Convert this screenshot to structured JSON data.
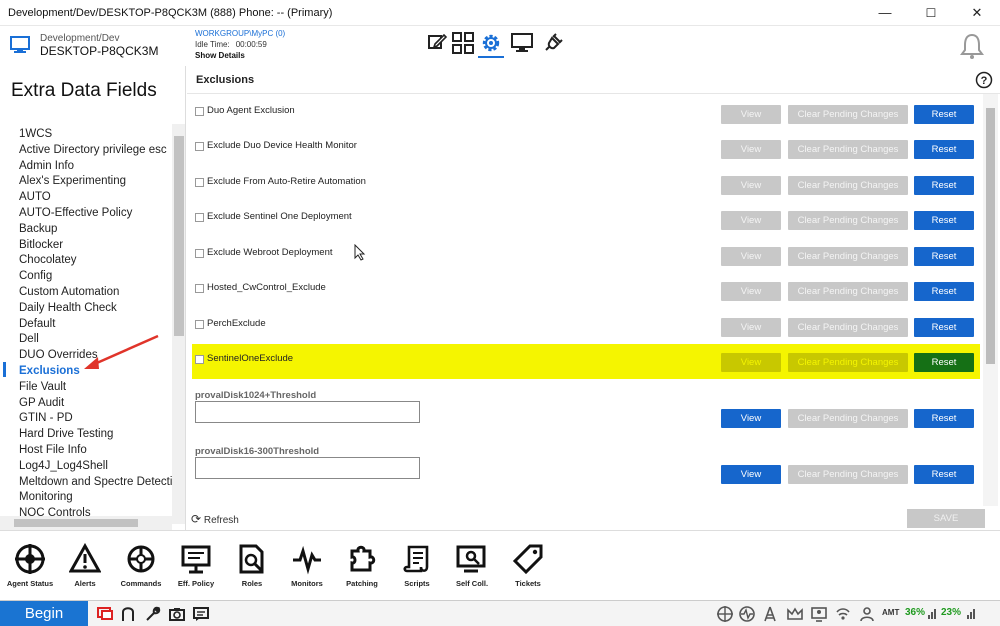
{
  "window": {
    "title": "Development/Dev/DESKTOP-P8QCK3M (888) Phone: -- (Primary)",
    "minimize": "—",
    "maximize": "☐",
    "close": "✕"
  },
  "header": {
    "path": "Development/Dev",
    "hostname": "DESKTOP-P8QCK3M",
    "workgroup": "WORKGROUP\\MyPC (0)",
    "idle_label": "Idle Time:",
    "idle_value": "00:00:59",
    "show_details": "Show Details",
    "icons": [
      "edit-icon",
      "grid-icon",
      "gear-icon",
      "monitor-icon",
      "plug-icon",
      "bell-icon"
    ]
  },
  "sidebar": {
    "title": "Extra Data Fields",
    "items": [
      "1WCS",
      "Active Directory privilege esc",
      "Admin Info",
      "Alex's Experimenting",
      "AUTO",
      "AUTO-Effective Policy",
      "Backup",
      "Bitlocker",
      "Chocolatey",
      "Config",
      "Custom Automation",
      "Daily Health Check",
      "Default",
      "Dell",
      "DUO Overrides",
      "Exclusions",
      "File Vault",
      "GP Audit",
      "GTIN - PD",
      "Hard Drive Testing",
      "Host File Info",
      "Log4J_Log4Shell",
      "Meltdown and Spectre Detection",
      "Monitoring",
      "NOC Controls"
    ],
    "active": "Exclusions"
  },
  "main": {
    "title": "Exclusions",
    "view_label": "View",
    "clear_label": "Clear Pending Changes",
    "reset_label": "Reset",
    "rows": [
      {
        "label": "Duo Agent Exclusion"
      },
      {
        "label": "Exclude Duo Device Health Monitor"
      },
      {
        "label": "Exclude From Auto-Retire Automation"
      },
      {
        "label": "Exclude Sentinel One Deployment"
      },
      {
        "label": "Exclude Webroot Deployment"
      },
      {
        "label": "Hosted_CwControl_Exclude"
      },
      {
        "label": "PerchExclude"
      },
      {
        "label": "SentinelOneExclude"
      }
    ],
    "thresholds": [
      {
        "label": "provalDisk1024+Threshold",
        "value": ""
      },
      {
        "label": "provalDisk16-300Threshold",
        "value": ""
      }
    ],
    "refresh_label": "Refresh",
    "save_label": "SAVE"
  },
  "toolbar": {
    "tools": [
      {
        "label": "Agent Status",
        "icon": "crosshair-icon"
      },
      {
        "label": "Alerts",
        "icon": "warning-icon"
      },
      {
        "label": "Commands",
        "icon": "command-icon"
      },
      {
        "label": "Eff. Policy",
        "icon": "policy-icon"
      },
      {
        "label": "Roles",
        "icon": "roles-icon"
      },
      {
        "label": "Monitors",
        "icon": "pulse-icon"
      },
      {
        "label": "Patching",
        "icon": "puzzle-icon"
      },
      {
        "label": "Scripts",
        "icon": "scroll-icon"
      },
      {
        "label": "Self Coll.",
        "icon": "self-collect-icon"
      },
      {
        "label": "Tickets",
        "icon": "ticket-icon"
      }
    ]
  },
  "statusbar": {
    "begin": "Begin",
    "amt": "AMT",
    "cpu_pct": "36%",
    "mem_pct": "23%"
  }
}
